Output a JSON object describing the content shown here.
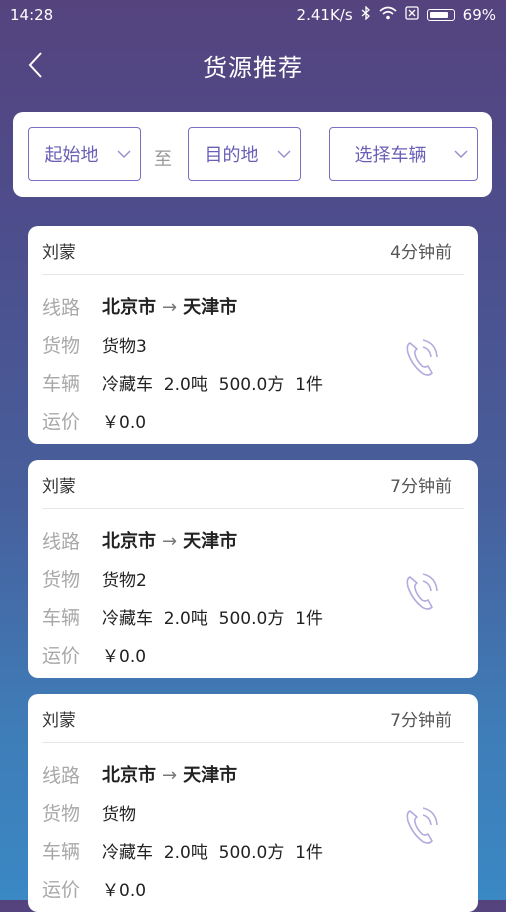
{
  "status_bar": {
    "time": "14:28",
    "speed": "2.41K/s",
    "battery": "69%"
  },
  "header": {
    "title": "货源推荐"
  },
  "filters": {
    "origin": "起始地",
    "to": "至",
    "destination": "目的地",
    "vehicle": "选择车辆"
  },
  "labels": {
    "route": "线路",
    "cargo": "货物",
    "vehicle": "车辆",
    "price": "运价"
  },
  "cards": [
    {
      "name": "刘蒙",
      "time": "4分钟前",
      "from": "北京市",
      "to": "天津市",
      "cargo": "货物3",
      "vehicle": "冷藏车  2.0吨  500.0方  1件",
      "price": "￥0.0"
    },
    {
      "name": "刘蒙",
      "time": "7分钟前",
      "from": "北京市",
      "to": "天津市",
      "cargo": "货物2",
      "vehicle": "冷藏车  2.0吨  500.0方  1件",
      "price": "￥0.0"
    },
    {
      "name": "刘蒙",
      "time": "7分钟前",
      "from": "北京市",
      "to": "天津市",
      "cargo": "货物",
      "vehicle": "冷藏车  2.0吨  500.0方  1件",
      "price": "￥0.0"
    }
  ]
}
